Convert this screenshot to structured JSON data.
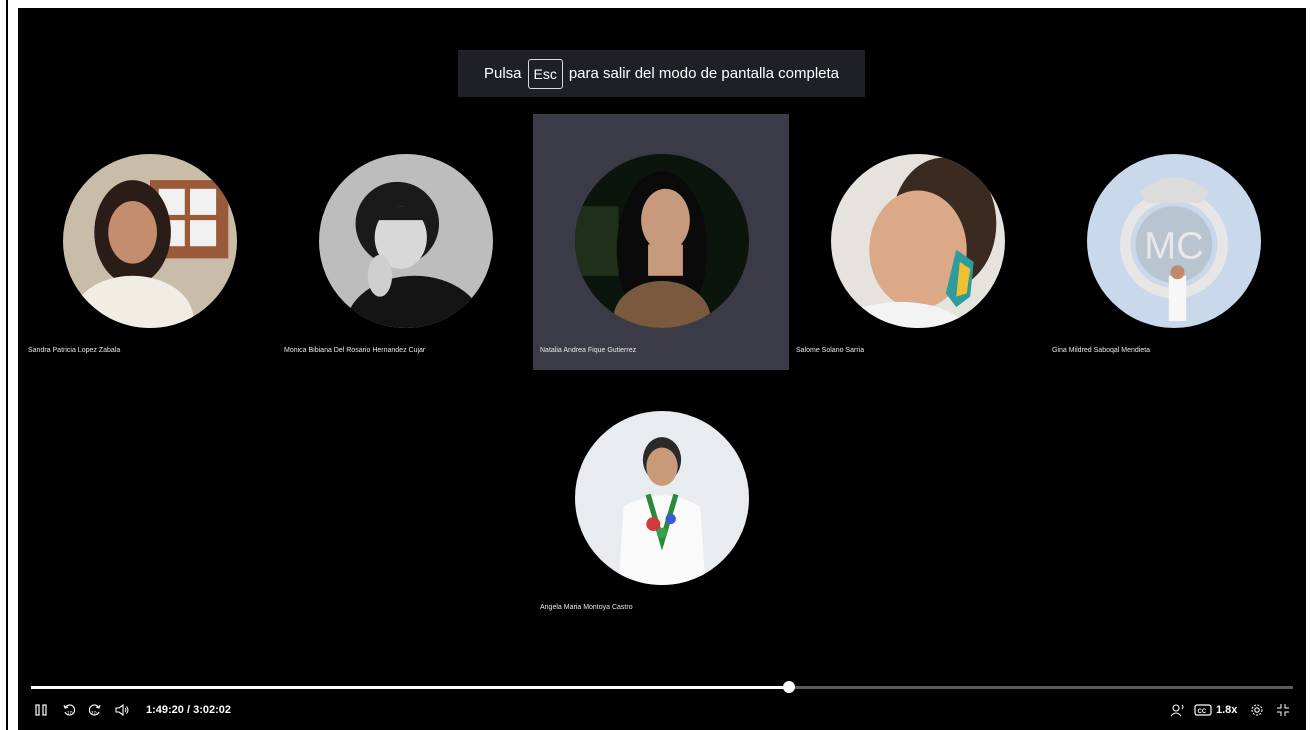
{
  "banner": {
    "prefix": "Pulsa",
    "key": "Esc",
    "suffix": "para salir del modo de pantalla completa"
  },
  "participants": [
    {
      "name": "Sandra Patricia Lopez Zabala",
      "active": false,
      "avatar": "woman-photo"
    },
    {
      "name": "Monica Bibiana Del Rosario Hernandez Cujar",
      "active": false,
      "avatar": "woman-bw-photo"
    },
    {
      "name": "Natalia Andrea Fique Gutierrez",
      "active": true,
      "avatar": "woman-night-photo"
    },
    {
      "name": "Salome Solano Sarria",
      "active": false,
      "avatar": "woman-earring-photo"
    },
    {
      "name": "Gina Mildred Saboqal Mendieta",
      "active": false,
      "avatar": "crest-photo"
    },
    {
      "name": "Angela Maria Montoya Castro",
      "active": false,
      "avatar": "woman-lanyard-photo"
    }
  ],
  "player": {
    "time": "1:49:20 / 3:02:02",
    "progress": 0.601,
    "speed": "1.8x",
    "icons": [
      "pause-icon",
      "rewind-10-icon",
      "forward-10-icon",
      "volume-icon",
      "voice-icon",
      "captions-icon",
      "settings-icon",
      "exit-fullscreen-icon"
    ]
  },
  "colors": {
    "background": "#000000",
    "active_tile": "#3b3b47",
    "banner": "#1f2025",
    "progress_track": "#5b5b5b",
    "progress_fill": "#ffffff"
  }
}
